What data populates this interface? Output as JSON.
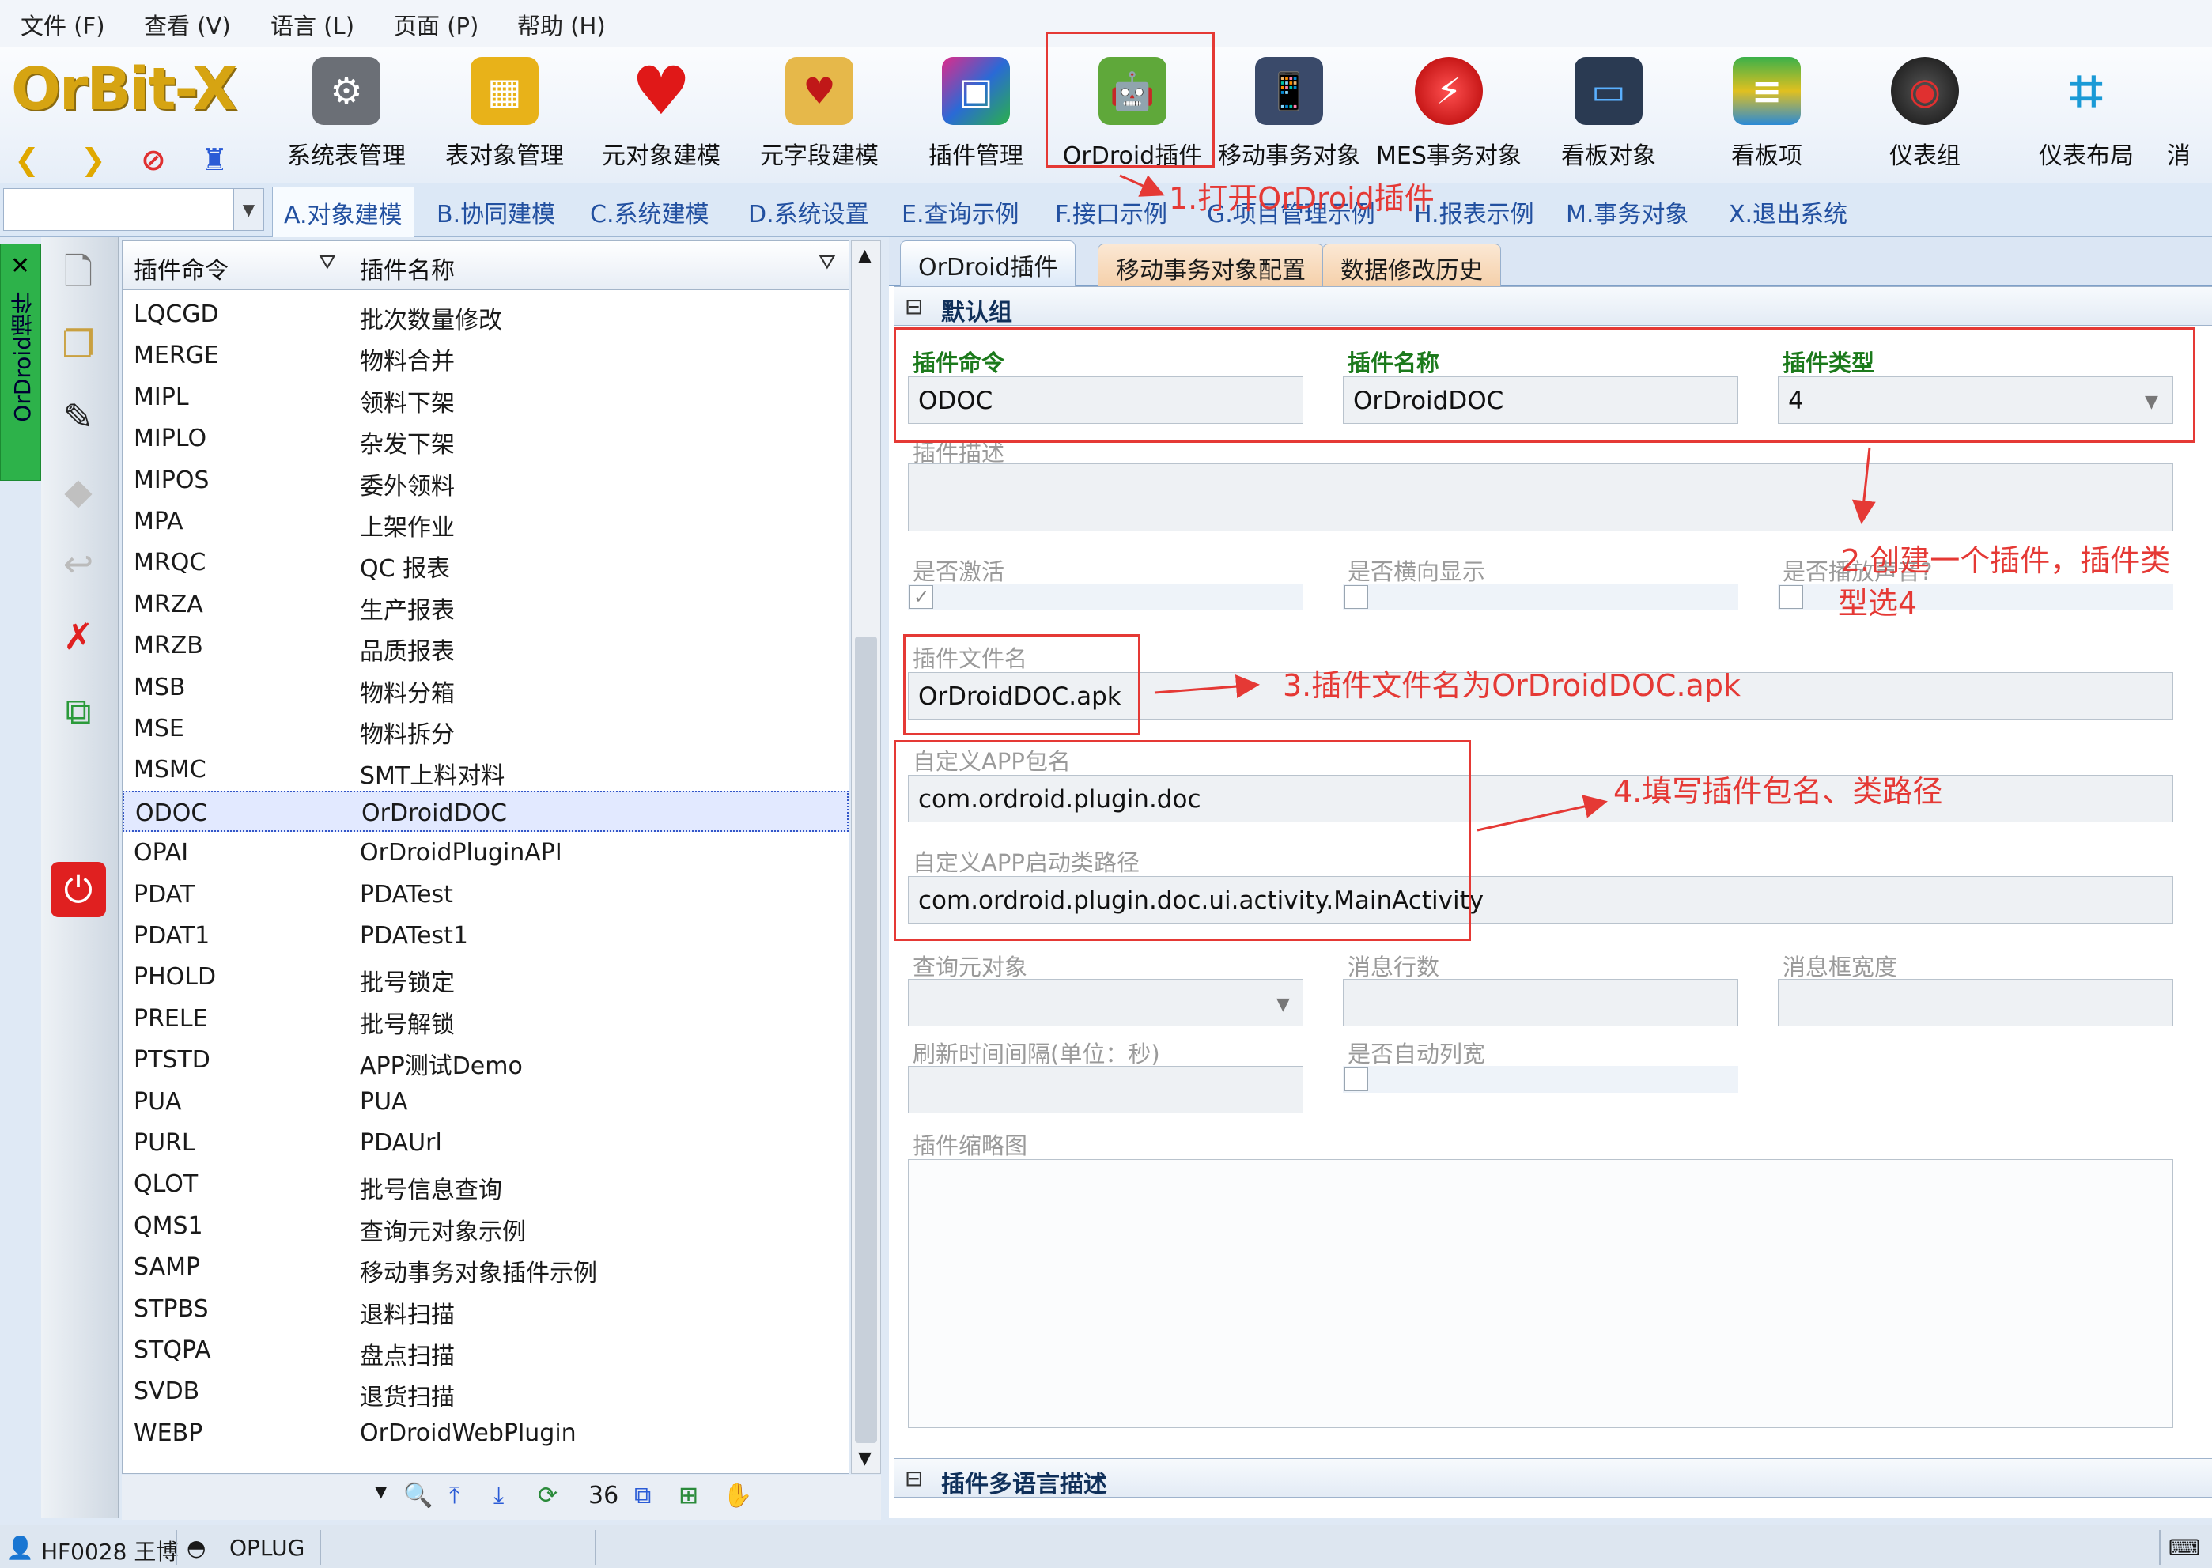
{
  "menu": [
    "文件 (F)",
    "查看 (V)",
    "语言 (L)",
    "页面 (P)",
    "帮助 (H)"
  ],
  "logo": {
    "text": "OrBit-X"
  },
  "toolbar": [
    {
      "label": "系统表管理",
      "icon": "table-manager-icon"
    },
    {
      "label": "表对象管理",
      "icon": "table-object-icon"
    },
    {
      "label": "元对象建模",
      "icon": "meta-object-heart-icon"
    },
    {
      "label": "元字段建模",
      "icon": "meta-field-icon"
    },
    {
      "label": "插件管理",
      "icon": "plugin-manage-icon"
    },
    {
      "label": "OrDroid插件",
      "icon": "android-icon"
    },
    {
      "label": "移动事务对象",
      "icon": "mobile-transaction-icon"
    },
    {
      "label": "MES事务对象",
      "icon": "mes-transaction-icon"
    },
    {
      "label": "看板对象",
      "icon": "monitor-icon"
    },
    {
      "label": "看板项",
      "icon": "board-item-icon"
    },
    {
      "label": "仪表组",
      "icon": "dashboard-group-icon"
    },
    {
      "label": "仪表布局",
      "icon": "dashboard-layout-icon"
    },
    {
      "label": "消",
      "icon": "more-icon"
    }
  ],
  "module_tabs": [
    "A.对象建模",
    "B.协同建模",
    "C.系统建模",
    "D.系统设置",
    "E.查询示例",
    "F.接口示例",
    "G.项目管理示例",
    "H.报表示例",
    "M.事务对象",
    "X.退出系统"
  ],
  "side_tab": "OrDroid插件",
  "list": {
    "col1": "插件命令",
    "col2": "插件名称",
    "rows": [
      [
        "LQCGD",
        "批次数量修改"
      ],
      [
        "MERGE",
        "物料合并"
      ],
      [
        "MIPL",
        "领料下架"
      ],
      [
        "MIPLO",
        "杂发下架"
      ],
      [
        "MIPOS",
        "委外领料"
      ],
      [
        "MPA",
        "上架作业"
      ],
      [
        "MRQC",
        "QC 报表"
      ],
      [
        "MRZA",
        "生产报表"
      ],
      [
        "MRZB",
        "品质报表"
      ],
      [
        "MSB",
        "物料分箱"
      ],
      [
        "MSE",
        "物料拆分"
      ],
      [
        "MSMC",
        "SMT上料对料"
      ],
      [
        "ODOC",
        "OrDroidDOC"
      ],
      [
        "OPAI",
        "OrDroidPluginAPI"
      ],
      [
        "PDAT",
        "PDATest"
      ],
      [
        "PDAT1",
        "PDATest1"
      ],
      [
        "PHOLD",
        "批号锁定"
      ],
      [
        "PRELE",
        "批号解锁"
      ],
      [
        "PTSTD",
        "APP测试Demo"
      ],
      [
        "PUA",
        "PUA"
      ],
      [
        "PURL",
        "PDAUrl"
      ],
      [
        "QLOT",
        "批号信息查询"
      ],
      [
        "QMS1",
        "查询元对象示例"
      ],
      [
        "SAMP",
        "移动事务对象插件示例"
      ],
      [
        "STPBS",
        "退料扫描"
      ],
      [
        "STQPA",
        "盘点扫描"
      ],
      [
        "SVDB",
        "退货扫描"
      ],
      [
        "WEBP",
        "OrDroidWebPlugin"
      ]
    ],
    "selected_index": 12,
    "record_count": "36"
  },
  "right_tabs": [
    "OrDroid插件",
    "移动事务对象配置",
    "数据修改历史"
  ],
  "form": {
    "group1": "默认组",
    "cmd_label": "插件命令",
    "cmd_value": "ODOC",
    "name_label": "插件名称",
    "name_value": "OrDroidDOC",
    "type_label": "插件类型",
    "type_value": "4",
    "desc_label": "插件描述",
    "active_label": "是否激活",
    "landscape_label": "是否横向显示",
    "sound_label": "是否播放声音?",
    "file_label": "插件文件名",
    "file_value": "OrDroidDOC.apk",
    "pkg_label": "自定义APP包名",
    "pkg_value": "com.ordroid.plugin.doc",
    "cls_label": "自定义APP启动类路径",
    "cls_value": "com.ordroid.plugin.doc.ui.activity.MainActivity",
    "query_label": "查询元对象",
    "msgrows_label": "消息行数",
    "msgwidth_label": "消息框宽度",
    "refresh_label": "刷新时间间隔(单位：秒)",
    "autocol_label": "是否自动列宽",
    "thumb_label": "插件缩略图",
    "group2": "插件多语言描述"
  },
  "annotations": {
    "a1": "1.打开OrDroid插件",
    "a2_line1": "2.创建一个插件，插件类",
    "a2_line2": "型选4",
    "a3": "3.插件文件名为OrDroidDOC.apk",
    "a4": "4.填写插件包名、类路径",
    "color": "#e53935"
  },
  "status": {
    "user": "HF0028 王博",
    "module": "OPLUG"
  }
}
